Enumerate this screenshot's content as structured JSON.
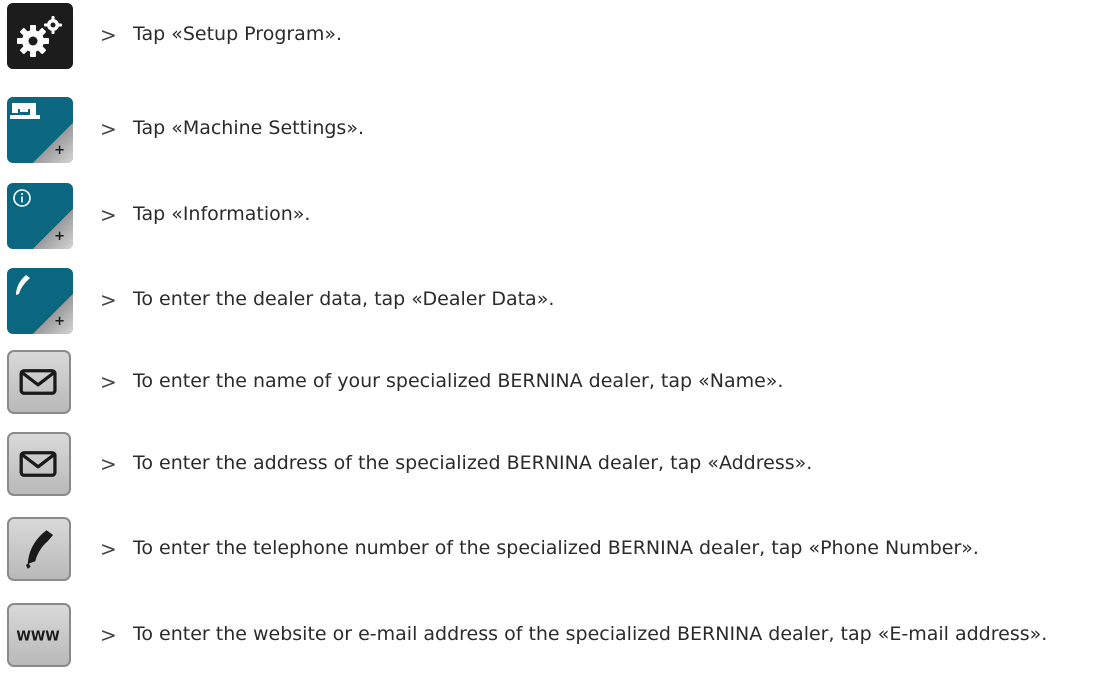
{
  "steps": [
    {
      "icon": "gear-icon",
      "marker": ">",
      "text": "Tap «Setup Program»."
    },
    {
      "icon": "sewing-machine-icon",
      "marker": ">",
      "text": "Tap «Machine Settings»."
    },
    {
      "icon": "info-icon",
      "marker": ">",
      "text": "Tap «Information»."
    },
    {
      "icon": "phone-icon",
      "marker": ">",
      "text": "To enter the dealer data, tap «Dealer Data»."
    },
    {
      "icon": "envelope-icon",
      "marker": ">",
      "text": "To enter the name of your specialized BERNINA dealer, tap «Name»."
    },
    {
      "icon": "envelope-icon",
      "marker": ">",
      "text": "To enter the address of the specialized BERNINA dealer, tap «Address»."
    },
    {
      "icon": "phone-icon",
      "marker": ">",
      "text": "To enter the telephone number of the specialized BERNINA dealer, tap «Phone Number»."
    },
    {
      "icon": "www-icon",
      "marker": ">",
      "text": "To enter the website or e-mail address of the specialized BERNINA dealer, tap «E-mail address»."
    }
  ],
  "buttons": {
    "plus_label": "+",
    "www_label": "WWW"
  },
  "colors": {
    "dark_button": "#1c1c1c",
    "blue_button": "#0b6680",
    "grey_button": "#c9c9c9"
  }
}
